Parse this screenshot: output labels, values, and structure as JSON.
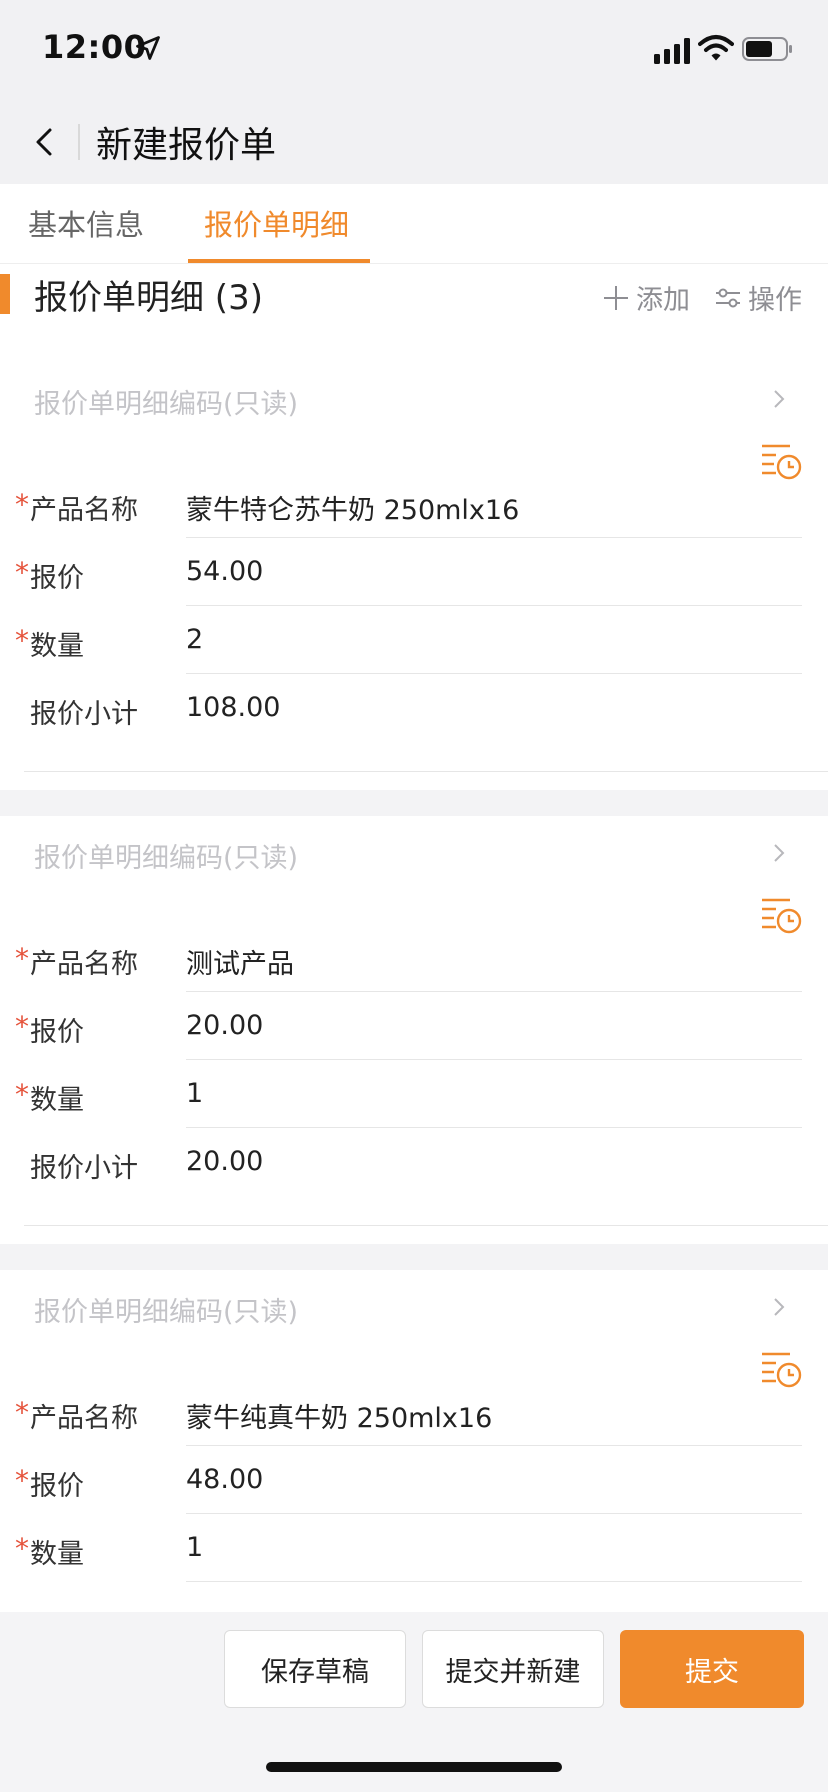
{
  "status_bar": {
    "time": "12:00"
  },
  "nav": {
    "title": "新建报价单"
  },
  "tabs": [
    {
      "label": "基本信息",
      "active": false
    },
    {
      "label": "报价单明细",
      "active": true
    }
  ],
  "section": {
    "title": "报价单明细 (3)",
    "add_label": "添加",
    "ops_label": "操作"
  },
  "required_mark": "*",
  "items": [
    {
      "code_placeholder": "报价单明细编码(只读)",
      "fields": [
        {
          "label": "产品名称",
          "value": "蒙牛特仑苏牛奶 250mlx16",
          "required": true
        },
        {
          "label": "报价",
          "value": "54.00",
          "required": true
        },
        {
          "label": "数量",
          "value": "2",
          "required": true
        },
        {
          "label": "报价小计",
          "value": "108.00",
          "required": false
        }
      ]
    },
    {
      "code_placeholder": "报价单明细编码(只读)",
      "fields": [
        {
          "label": "产品名称",
          "value": "测试产品",
          "required": true
        },
        {
          "label": "报价",
          "value": "20.00",
          "required": true
        },
        {
          "label": "数量",
          "value": "1",
          "required": true
        },
        {
          "label": "报价小计",
          "value": "20.00",
          "required": false
        }
      ]
    },
    {
      "code_placeholder": "报价单明细编码(只读)",
      "fields": [
        {
          "label": "产品名称",
          "value": "蒙牛纯真牛奶 250mlx16",
          "required": true
        },
        {
          "label": "报价",
          "value": "48.00",
          "required": true
        },
        {
          "label": "数量",
          "value": "1",
          "required": true
        }
      ]
    }
  ],
  "footer": {
    "save_draft": "保存草稿",
    "submit_and_new": "提交并新建",
    "submit": "提交"
  },
  "colors": {
    "accent": "#f08a2c",
    "required": "#e5533b"
  }
}
